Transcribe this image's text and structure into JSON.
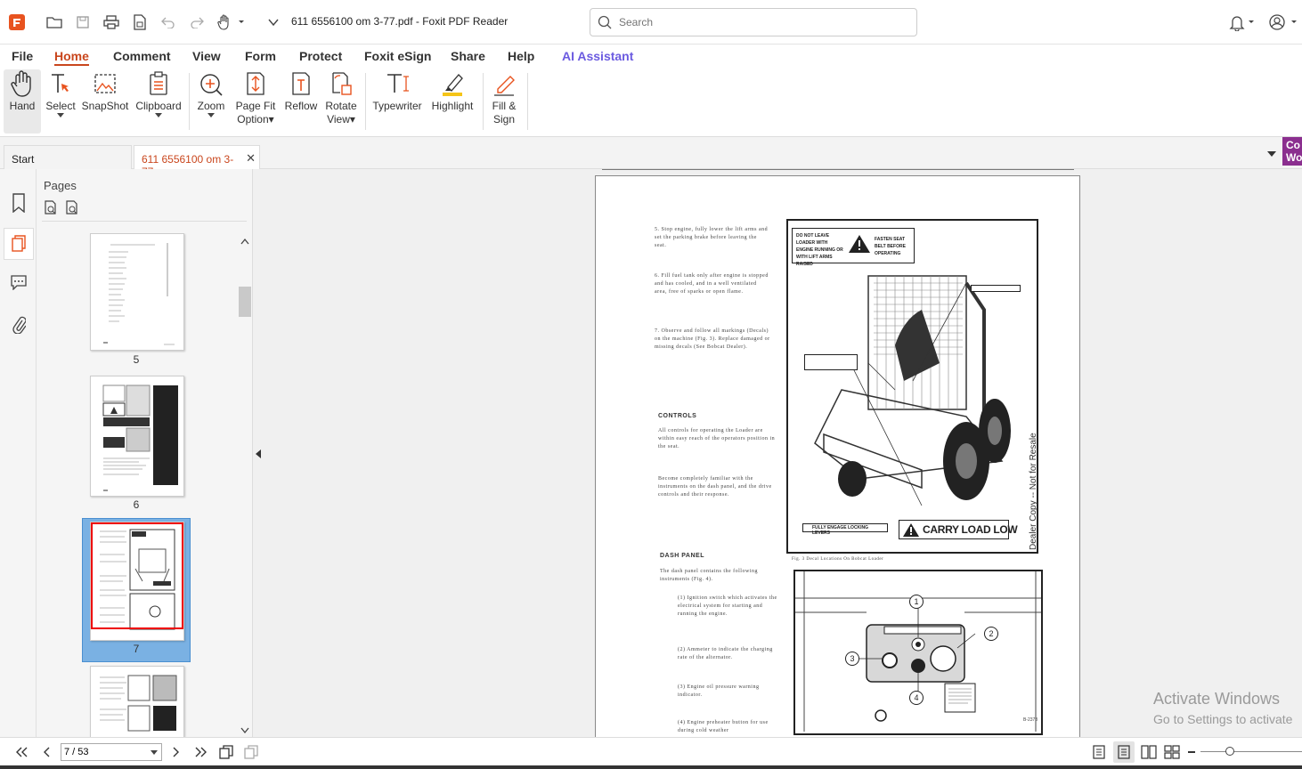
{
  "window": {
    "title": "611 6556100 om 3-77.pdf - Foxit PDF Reader"
  },
  "search": {
    "placeholder": "Search"
  },
  "menu": {
    "items": [
      "File",
      "Home",
      "Comment",
      "View",
      "Form",
      "Protect",
      "Foxit eSign",
      "Share",
      "Help",
      "AI Assistant"
    ],
    "active": "Home"
  },
  "ribbon": {
    "hand": "Hand",
    "select": "Select",
    "snapshot": "SnapShot",
    "clipboard": "Clipboard",
    "zoom": "Zoom",
    "page_fit_1": "Page Fit",
    "page_fit_2": "Option",
    "reflow": "Reflow",
    "rotate_1": "Rotate",
    "rotate_2": "View",
    "typewriter": "Typewriter",
    "highlight": "Highlight",
    "fill_1": "Fill &",
    "fill_2": "Sign"
  },
  "tabs": {
    "start": "Start",
    "doc": "611 6556100 om 3-77...."
  },
  "badge": {
    "line1": "Co",
    "line2": "Wo"
  },
  "panel": {
    "title": "Pages",
    "pages": [
      "5",
      "6",
      "7"
    ],
    "selected": "7"
  },
  "document": {
    "item5": "5.   Stop engine, fully lower the lift arms and set the parking brake before leaving the seat.",
    "item6": "6.   Fill fuel tank only after engine is stopped and has cooled, and in a well ventilated area, free of sparks or open flame.",
    "item7": "7.   Observe and follow all markings (Decals) on the machine (Fig. 3). Replace damaged or missing decals (See Bobcat Dealer).",
    "controls_head": "CONTROLS",
    "controls_p1": "All controls for operating the Loader are within easy reach of the operators position in the seat.",
    "controls_p2": "Become completely familiar with the instruments on the dash panel, and the drive controls and their response.",
    "dash_head": "DASH PANEL",
    "dash_p": "The dash panel contains the following instruments (Fig. 4).",
    "dash_1": "(1)   Ignition switch which activates the electrical system for starting and running the engine.",
    "dash_2": "(2)   Ammeter to indicate the charging rate of the alternator.",
    "dash_3": "(3)   Engine oil pressure warning indicator.",
    "dash_4": "(4)   Engine preheater button for use during cold weather",
    "decal_leave": "DO NOT LEAVE LOADER WITH ENGINE RUNNING OR WITH LIFT ARMS RAISED",
    "decal_belt": "FASTEN SEAT BELT BEFORE OPERATING",
    "decal_carry": "CARRY LOAD LOW",
    "decal_levers": "FULLY ENGAGE LOCKING LEVERS",
    "fig3": "Fig. 3   Decal Locations On Bobcat Loader",
    "fig4_id": "B-2373",
    "dealer": "Dealer Copy -- Not for Resale",
    "callouts": [
      "1",
      "2",
      "3",
      "4"
    ]
  },
  "watermark": {
    "line1": "Activate Windows",
    "line2": "Go to Settings to activate"
  },
  "status": {
    "page_value": "7 / 53"
  }
}
